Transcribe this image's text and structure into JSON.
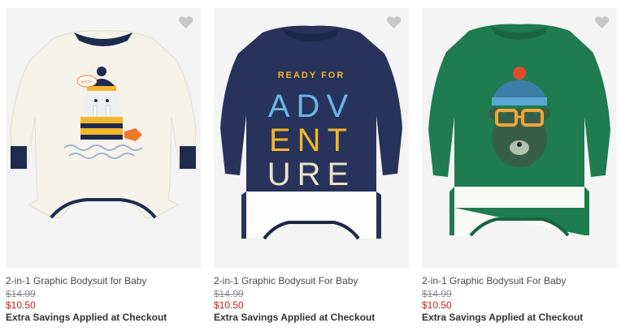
{
  "colors": {
    "sale": "#cc1b1b",
    "strikethrough": "#8d8d8d",
    "heart": "#c8c8c8"
  },
  "products": [
    {
      "title": "2-in-1 Graphic Bodysuit for Baby",
      "old_price": "$14.99",
      "new_price": "$10.50",
      "promo": "Extra Savings Applied at Checkout",
      "graphic_text": "AHOY!",
      "favorite_icon": "heart-icon"
    },
    {
      "title": "2-in-1 Graphic Bodysuit For Baby",
      "old_price": "$14.99",
      "new_price": "$10.50",
      "promo": "Extra Savings Applied at Checkout",
      "graphic_text_top": "READY FOR",
      "graphic_text_1": "ADV",
      "graphic_text_2": "ENT",
      "graphic_text_3": "URE",
      "favorite_icon": "heart-icon"
    },
    {
      "title": "2-in-1 Graphic Bodysuit For Baby",
      "old_price": "$14.99",
      "new_price": "$10.50",
      "promo": "Extra Savings Applied at Checkout",
      "favorite_icon": "heart-icon"
    }
  ]
}
